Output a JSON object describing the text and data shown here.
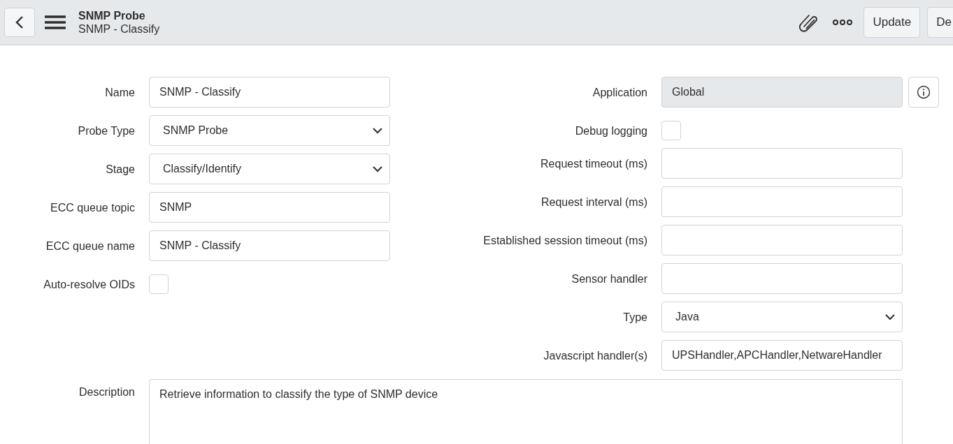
{
  "header": {
    "title": "SNMP Probe",
    "subtitle": "SNMP - Classify",
    "buttons": [
      "Update",
      "De"
    ]
  },
  "left_fields": [
    {
      "label": "Name",
      "kind": "text",
      "value": "SNMP - Classify"
    },
    {
      "label": "Probe Type",
      "kind": "select",
      "value": "SNMP Probe"
    },
    {
      "label": "Stage",
      "kind": "select",
      "value": "Classify/Identify"
    },
    {
      "label": "ECC queue topic",
      "kind": "text",
      "value": "SNMP"
    },
    {
      "label": "ECC queue name",
      "kind": "text",
      "value": "SNMP - Classify"
    },
    {
      "label": "Auto-resolve OIDs",
      "kind": "checkbox",
      "checked": false
    }
  ],
  "right_fields": [
    {
      "label": "Application",
      "kind": "readonly",
      "value": "Global"
    },
    {
      "label": "Debug logging",
      "kind": "checkbox",
      "checked": false
    },
    {
      "label": "Request timeout (ms)",
      "kind": "text"
    },
    {
      "label": "Request interval (ms)",
      "kind": "text"
    },
    {
      "label": "Established session timeout (ms)",
      "kind": "text"
    },
    {
      "label": "Sensor handler",
      "kind": "text"
    },
    {
      "label": "Type",
      "kind": "select",
      "value": "Java"
    },
    {
      "label": "Javascript handler(s)",
      "kind": "text",
      "value": "UPSHandler,APCHandler,NetwareHandler"
    }
  ],
  "description": {
    "label": "Description",
    "value": "Retrieve information to classify the type of SNMP device"
  }
}
